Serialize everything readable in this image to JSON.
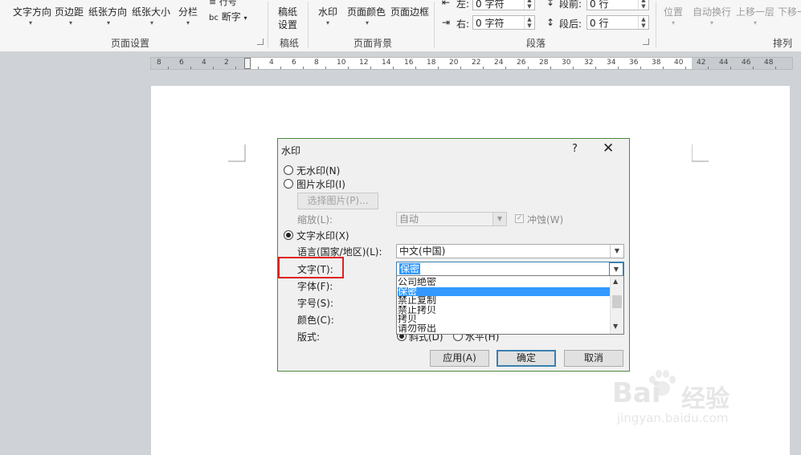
{
  "ribbon": {
    "buttons": [
      "文字方向",
      "页边距",
      "纸张方向",
      "纸张大小",
      "分栏"
    ],
    "line_numbers": "行号",
    "hyphenation": "断字",
    "manuscript": [
      "稿纸",
      "设置"
    ],
    "watermark": "水印",
    "page_color": "页面颜色",
    "page_border": "页面边框",
    "indent_left_label": "左:",
    "indent_left_value": "0 字符",
    "indent_right_label": "右:",
    "indent_right_value": "0 字符",
    "spacing_before_label": "段前:",
    "spacing_before_value": "0 行",
    "spacing_after_label": "段后:",
    "spacing_after_value": "0 行",
    "position": "位置",
    "wrap_text": "自动换行",
    "bring_forward": "上移一层",
    "send_backward": "下移一",
    "groups": {
      "page_setup": "页面设置",
      "manuscript": "稿纸",
      "page_background": "页面背景",
      "paragraph": "段落",
      "arrange": "排列"
    }
  },
  "ruler": {
    "labels": [
      "8",
      "6",
      "4",
      "2",
      "2",
      "4",
      "6",
      "8",
      "10",
      "12",
      "14",
      "16",
      "18",
      "20",
      "22",
      "24",
      "26",
      "28",
      "30",
      "32",
      "34",
      "36",
      "38",
      "40",
      "42",
      "44",
      "46",
      "48"
    ]
  },
  "dialog": {
    "title": "水印",
    "help": "?",
    "close": "✕",
    "no_watermark": "无水印(N)",
    "picture_watermark": "图片水印(I)",
    "select_picture": "选择图片(P)...",
    "scale_label": "缩放(L):",
    "scale_value": "自动",
    "washout": "冲蚀(W)",
    "text_watermark": "文字水印(X)",
    "language_label": "语言(国家/地区)(L):",
    "language_value": "中文(中国)",
    "text_label": "文字(T):",
    "text_value": "保密",
    "font_label": "字体(F):",
    "size_label": "字号(S):",
    "color_label": "颜色(C):",
    "layout_label": "版式:",
    "layout_diagonal": "斜式(D)",
    "layout_horizontal": "水平(H)",
    "dropdown_items": [
      "公司绝密",
      "保密",
      "禁止复制",
      "禁止拷贝",
      "拷贝",
      "请勿带出"
    ],
    "dropdown_selected_index": 1,
    "apply": "应用(A)",
    "ok": "确定",
    "cancel": "取消"
  },
  "watermark_overlay": {
    "brand": "Bai",
    "brand_tail": "经验",
    "url": "jingyan.baidu.com"
  },
  "colors": {
    "dialog_border": "#4c8a3c",
    "selection": "#3399ff",
    "highlight_box": "#e02020"
  }
}
